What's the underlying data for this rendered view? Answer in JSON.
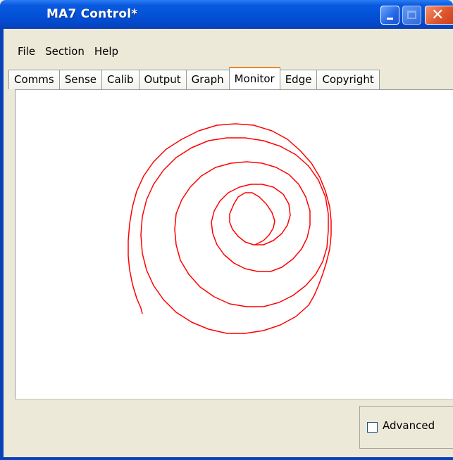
{
  "window": {
    "title": "MA7 Control*"
  },
  "menu": [
    "File",
    "Section",
    "Help"
  ],
  "tabs": [
    {
      "label": "Comms",
      "active": false
    },
    {
      "label": "Sense",
      "active": false
    },
    {
      "label": "Calib",
      "active": false
    },
    {
      "label": "Output",
      "active": false
    },
    {
      "label": "Graph",
      "active": false
    },
    {
      "label": "Monitor",
      "active": true
    },
    {
      "label": "Edge",
      "active": false
    },
    {
      "label": "Copyright",
      "active": false
    }
  ],
  "monitor": {
    "trace_color": "#ff0000"
  },
  "options": {
    "advanced_label": "Advanced",
    "advanced_checked": false
  },
  "colors": {
    "titlebar": "#0352d8",
    "window_bg": "#ece9d8",
    "close_button": "#e0572d"
  }
}
